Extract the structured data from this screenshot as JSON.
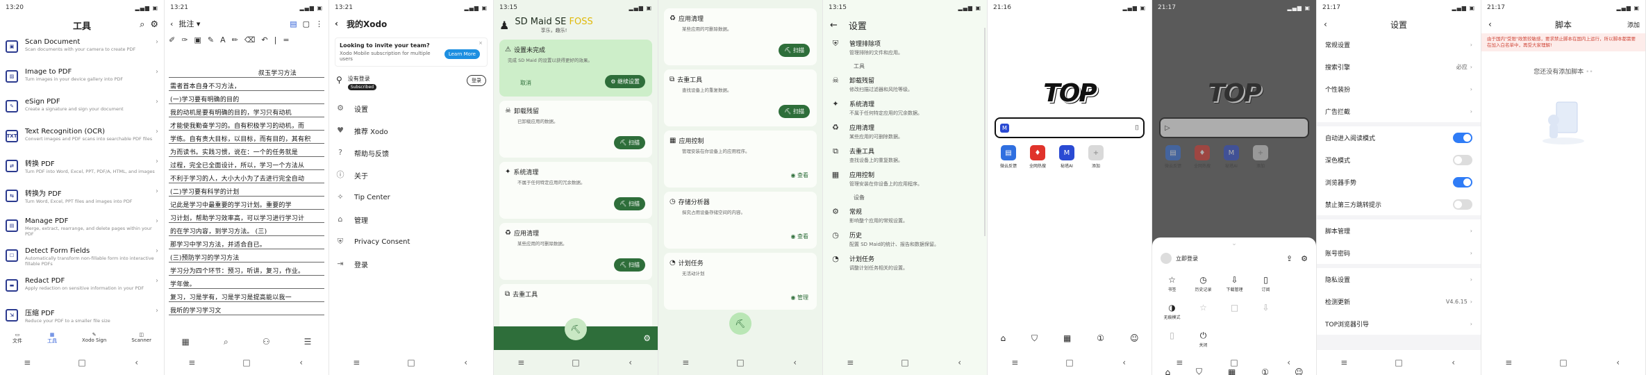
{
  "screens": {
    "tools": {
      "time": "13:20",
      "title": "工具",
      "items": [
        {
          "title": "Scan Document",
          "desc": "Scan documents with your camera to create PDF"
        },
        {
          "title": "Image to PDF",
          "desc": "Turn images in your device gallery into PDF"
        },
        {
          "title": "eSign PDF",
          "desc": "Create a signature and sign your document"
        },
        {
          "title": "Text Recognition (OCR)",
          "desc": "Convert images and PDF scans into searchable PDF files"
        },
        {
          "title": "转换 PDF",
          "desc": "Turn PDF into Word, Excel, PPT, PDF/A, HTML, and images"
        },
        {
          "title": "转换为 PDF",
          "desc": "Turn Word, Excel, PPT files and images into PDF"
        },
        {
          "title": "Manage PDF",
          "desc": "Merge, extract, rearrange, and delete pages within your PDF"
        },
        {
          "title": "Detect Form Fields",
          "desc": "Automatically transform non-fillable form into interactive fillable PDFs"
        },
        {
          "title": "Redact PDF",
          "desc": "Apply redaction on sensitive information in your PDF"
        },
        {
          "title": "压缩 PDF",
          "desc": "Reduce your PDF to a smaller file size"
        }
      ],
      "nav": [
        "文件",
        "工具",
        "Xodo Sign",
        "Scanner"
      ]
    },
    "annot": {
      "time": "13:21",
      "mode": "批注",
      "lines": [
        "叔玉学习方法",
        "需者首本自身不习方法，",
        "(一)学习要有明确的目的",
        "我的动机是要有明确的目的，学习只有动机",
        "才能使我勤奋学习的。自有积极学习的动机，而",
        "学练。自有责大目标，以目标，而有目的，其有积",
        "为而读书。实践习惯，说在：一个的任务就是",
        "过程，完全已全面设计，所以，学习一个方法从",
        "不利于学习的人，大小大小为了去进行完全自动",
        "(二)学习要有科学的计划",
        "记此是学习中最重要的学习计划。重要的学",
        "习计划，帮助学习效率高，可以学习进行学习计",
        "的在学习内容，到学习方法。 (三)",
        "那学习中学习方法，并适合自已。",
        "(三)预防学习的学习方法",
        "学习分为四个环节：预习，听讲，复习，作业。",
        "学年做。",
        "复习，习是学有，习是学习是提高能以我一",
        "我听的学习学习文"
      ],
      "nav": [
        "▦",
        "⌕",
        "⚇",
        "☰"
      ]
    },
    "xodo": {
      "time": "13:21",
      "title": "我的Xodo",
      "invite_title": "Looking to invite your team?",
      "invite_desc": "Xodo Mobile subscription for multiple users",
      "invite_btn": "Learn More",
      "account_name": "没有登录",
      "account_badge": "Subscribed",
      "login_btn": "登录",
      "menu": [
        "设置",
        "推荐 Xodo",
        "帮助与反馈",
        "关于",
        "Tip Center",
        "管理",
        "Privacy Consent",
        "登录"
      ]
    },
    "sdmaid1": {
      "time": "13:15",
      "app": "SD Maid SE",
      "app_accent": "FOSS",
      "tagline": "享乐，趣乐!",
      "setup_title": "设置未完成",
      "setup_desc": "完成 SD Maid 的设置以获得更好的效果。",
      "setup_cancel": "取消",
      "setup_btn": "继续设置",
      "cards": [
        {
          "title": "卸载残留",
          "desc": "已卸载应用的数据。",
          "btn": "扫描"
        },
        {
          "title": "系统清理",
          "desc": "不属于任何特定应用的冗余数据。",
          "btn": "扫描"
        },
        {
          "title": "应用清理",
          "desc": "某些应用的可删除数据。",
          "btn": "扫描"
        },
        {
          "title": "去重工具",
          "desc": "",
          "btn": ""
        }
      ]
    },
    "sdmaid2": {
      "cards": [
        {
          "title": "应用清理",
          "desc": "某些应用的可删除数据。",
          "btn": "扫描"
        },
        {
          "title": "去重工具",
          "desc": "查找设备上的重复数据。",
          "btn": "扫描"
        },
        {
          "title": "应用控制",
          "desc": "管理安装在你设备上的应用程序。",
          "btn": "查看"
        },
        {
          "title": "存储分析器",
          "desc": "探究占用设备存储空间的内容。",
          "btn": "查看"
        },
        {
          "title": "计划任务",
          "desc": "无活动计划",
          "btn": "管理"
        }
      ]
    },
    "settings": {
      "time": "13:15",
      "title": "设置",
      "top": {
        "title": "管理排除项",
        "desc": "管理排除的文件和应用。"
      },
      "section_tools": "工具",
      "tools": [
        {
          "title": "卸载残留",
          "desc": "修改扫描过滤器和风险等级。"
        },
        {
          "title": "系统清理",
          "desc": "不属于任何特定应用的冗余数据。"
        },
        {
          "title": "应用清理",
          "desc": "某些应用的可删除数据。"
        },
        {
          "title": "去重工具",
          "desc": "查找设备上的重复数据。"
        },
        {
          "title": "应用控制",
          "desc": "管理安装在你设备上的应用程序。"
        }
      ],
      "section_settings": "设备",
      "settings": [
        {
          "title": "常规",
          "desc": "影响整个应用的常规设置。"
        },
        {
          "title": "历史",
          "desc": "配置 SD Maid的统计、报告和数据保留。"
        },
        {
          "title": "计划任务",
          "desc": "调整计划任务相关的设置。"
        }
      ]
    },
    "top1": {
      "time": "21:16",
      "logo": "TOP",
      "quick": [
        "微云反馈",
        "全网热搜",
        "秘塔AI",
        "添加"
      ],
      "quick_colors": [
        "#2f6fe0",
        "#e0332b",
        "#2a4ad3",
        "#d9d9d9"
      ]
    },
    "top2": {
      "time": "21:17",
      "login": "立即登录",
      "grid": [
        "书签",
        "历史记录",
        "下载管理",
        "订阅",
        "无痕模式",
        "",
        "",
        "",
        "",
        "关闭"
      ]
    },
    "top3": {
      "time": "21:17",
      "title": "设置",
      "rows": [
        {
          "label": "常规设置",
          "value": ""
        },
        {
          "label": "搜索引擎",
          "value": "必应"
        },
        {
          "label": "个性装扮",
          "value": ""
        },
        {
          "label": "广告拦截",
          "value": ""
        }
      ],
      "toggles": [
        {
          "label": "自动进入阅读模式",
          "on": true
        },
        {
          "label": "深色模式",
          "on": false
        },
        {
          "label": "浏览器手势",
          "on": true
        },
        {
          "label": "禁止第三方跳转提示",
          "on": false
        }
      ],
      "rows2": [
        {
          "label": "脚本管理",
          "value": ""
        },
        {
          "label": "账号密码",
          "value": ""
        }
      ],
      "rows3": [
        {
          "label": "隐私设置",
          "value": ""
        },
        {
          "label": "检测更新",
          "value": "V4.6.15"
        },
        {
          "label": "TOP浏览器引导",
          "value": ""
        }
      ]
    },
    "top4": {
      "time": "21:17",
      "title": "脚本",
      "add": "添加",
      "warning": "由于国内\"受限\"政策较敏感，要求禁止脚本在国内上运行，所以脚本都需要在加入白名单中，再受大家理解!",
      "empty": "您还没有添加脚本"
    }
  }
}
